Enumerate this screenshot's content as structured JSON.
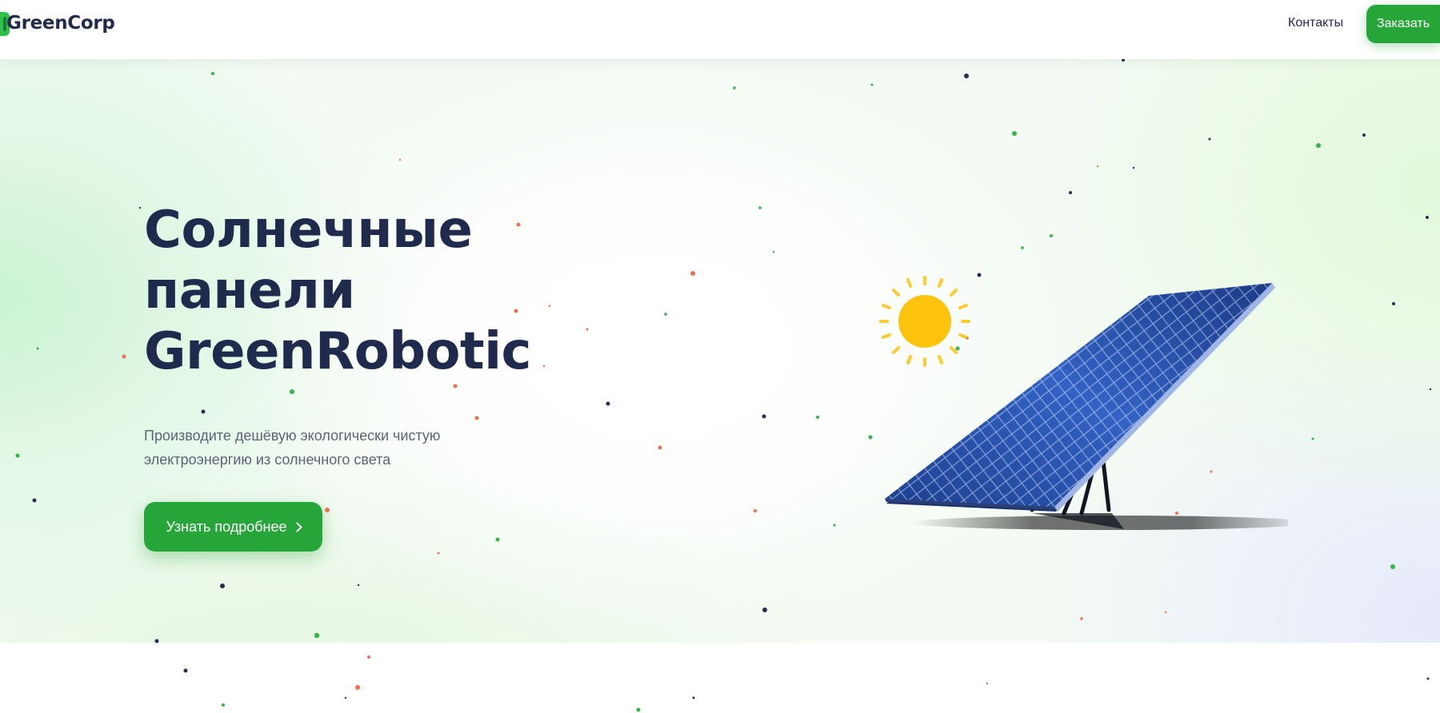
{
  "header": {
    "logo_text": "GreenCorp",
    "nav_contacts": "Контакты",
    "order_button": "Заказать"
  },
  "hero": {
    "title_lines": [
      "Солнечные",
      "панели",
      "GreenRobotic"
    ],
    "subtitle": "Производите дешёвую экологически чистую электроэнергию из солнечного света",
    "cta_label": "Узнать подробнее"
  },
  "icons": {
    "logo": "logo-icon",
    "cta": "chevron-right-icon",
    "illustration_sun": "sun-icon",
    "illustration_panel": "solar-panel-icon"
  },
  "colors": {
    "accent_green": "#26a539",
    "heading_navy": "#1f2a4d",
    "subtitle_gray": "#5c6478",
    "sun_yellow": "#fec30c",
    "panel_blue": "#2a4fa8",
    "particle_green": "#35b44a",
    "particle_orange": "#f2704e",
    "particle_navy": "#25304e"
  }
}
